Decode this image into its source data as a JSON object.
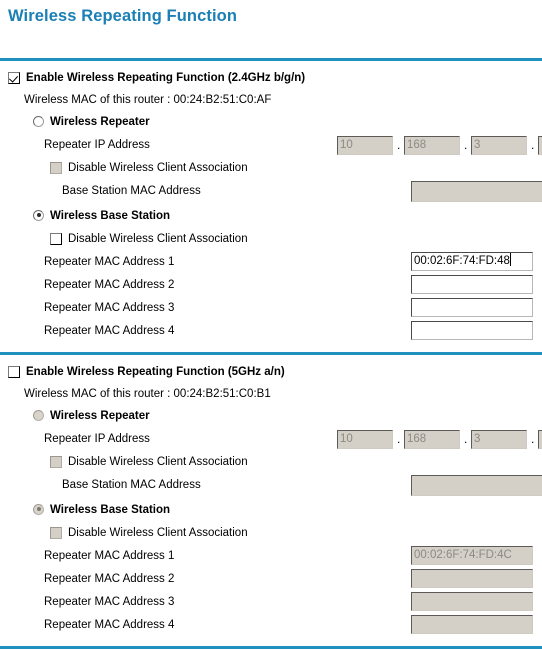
{
  "page": {
    "title": "Wireless Repeating Function",
    "accent_color": "#2091bf",
    "title_color": "#1a7fb5"
  },
  "labels": {
    "router_mac_prefix": "Wireless MAC of this router : ",
    "wireless_repeater": "Wireless Repeater",
    "wireless_base_station": "Wireless Base Station",
    "repeater_ip_address": "Repeater IP Address",
    "disable_client_association": "Disable Wireless Client Association",
    "base_station_mac_address": "Base Station MAC Address",
    "repeater_mac_1": "Repeater MAC Address 1",
    "repeater_mac_2": "Repeater MAC Address 2",
    "repeater_mac_3": "Repeater MAC Address 3",
    "repeater_mac_4": "Repeater MAC Address 4",
    "dot": "."
  },
  "band_24": {
    "enable_label": "Enable Wireless Repeating Function (2.4GHz b/g/n)",
    "enabled": true,
    "router_mac": "00:24:B2:51:C0:AF",
    "router_mac_line": "Wireless MAC of this router : 00:24:B2:51:C0:AF",
    "mode": "base_station",
    "repeater": {
      "selected": false,
      "ip_octets": [
        "10",
        "168",
        "3",
        ""
      ],
      "disable_client_association": false,
      "base_station_mac": ""
    },
    "base_station": {
      "selected": true,
      "disable_client_association": false,
      "repeater_macs": [
        "00:02:6F:74:FD:48",
        "",
        "",
        ""
      ]
    }
  },
  "band_5": {
    "enable_label": "Enable Wireless Repeating Function (5GHz a/n)",
    "enabled": false,
    "router_mac": "00:24:B2:51:C0:B1",
    "router_mac_line": "Wireless MAC of this router : 00:24:B2:51:C0:B1",
    "mode": "base_station",
    "repeater": {
      "selected": false,
      "ip_octets": [
        "10",
        "168",
        "3",
        ""
      ],
      "disable_client_association": false,
      "base_station_mac": ""
    },
    "base_station": {
      "selected": true,
      "disable_client_association": false,
      "repeater_macs": [
        "00:02:6F:74:FD:4C",
        "",
        "",
        ""
      ]
    }
  }
}
